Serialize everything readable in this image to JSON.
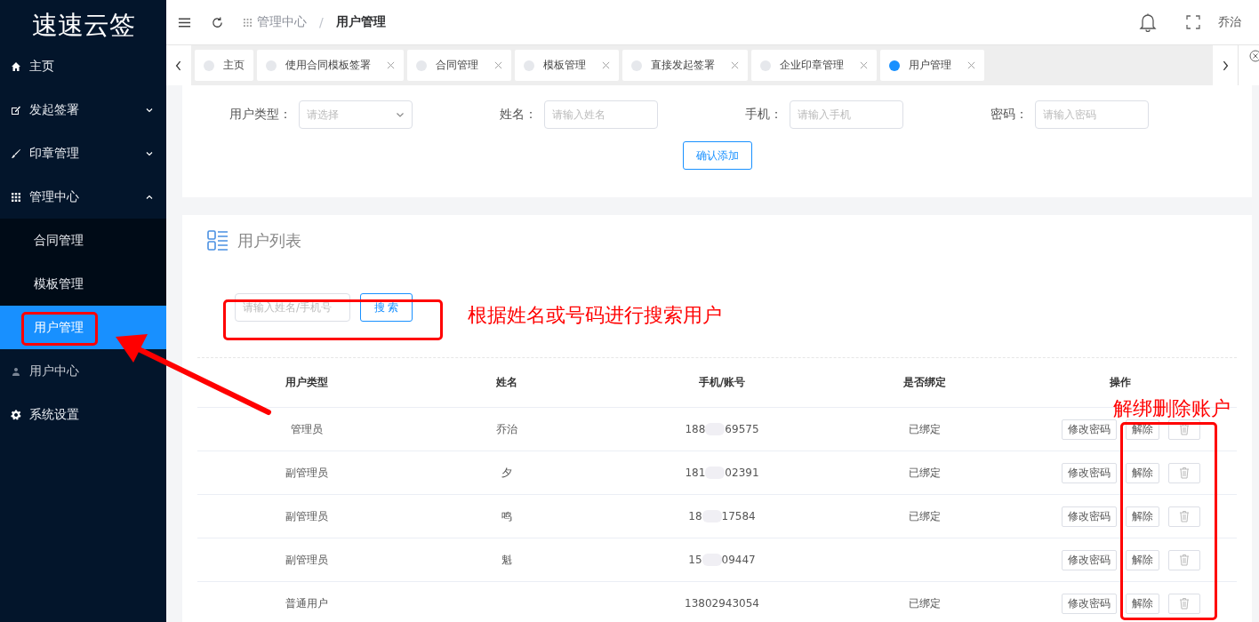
{
  "sidebar": {
    "logo": "速速云签",
    "items": [
      {
        "label": "主页",
        "selected": false
      },
      {
        "label": "发起签署",
        "expanded": false,
        "selected": false
      },
      {
        "label": "印章管理",
        "expanded": false,
        "selected": false
      },
      {
        "label": "管理中心",
        "expanded": true,
        "selected": false,
        "children": [
          {
            "label": "合同管理",
            "selected": false
          },
          {
            "label": "模板管理",
            "selected": false
          },
          {
            "label": "用户管理",
            "selected": true
          }
        ]
      },
      {
        "label": "用户中心",
        "selected": false
      },
      {
        "label": "系统设置",
        "selected": false
      }
    ]
  },
  "header": {
    "breadcrumb": [
      "管理中心",
      "/",
      "用户管理"
    ],
    "user": "乔治"
  },
  "tabs": [
    {
      "label": "主页",
      "closable": false,
      "selected": false
    },
    {
      "label": "使用合同模板签署",
      "closable": true,
      "selected": false
    },
    {
      "label": "合同管理",
      "closable": true,
      "selected": false
    },
    {
      "label": "模板管理",
      "closable": true,
      "selected": false
    },
    {
      "label": "直接发起签署",
      "closable": true,
      "selected": false
    },
    {
      "label": "企业印章管理",
      "closable": true,
      "selected": false
    },
    {
      "label": "用户管理",
      "closable": true,
      "selected": true
    }
  ],
  "add_form": {
    "fields": [
      {
        "label": "用户类型：",
        "kind": "select",
        "placeholder": "请选择"
      },
      {
        "label": "姓名：",
        "kind": "input",
        "placeholder": "请输入姓名"
      },
      {
        "label": "手机：",
        "kind": "input",
        "placeholder": "请输入手机"
      },
      {
        "label": "密码：",
        "kind": "input",
        "placeholder": "请输入密码"
      }
    ],
    "submit": "确认添加"
  },
  "user_list": {
    "title": "用户列表",
    "search": {
      "placeholder": "请输入姓名/手机号",
      "button": "搜 索"
    },
    "table": {
      "columns": [
        "用户类型",
        "姓名",
        "手机/账号",
        "是否绑定",
        "操作"
      ],
      "rows": [
        {
          "type": "管理员",
          "name": "乔治",
          "phone_start": "188",
          "phone_end": "69575",
          "bound": "已绑定",
          "actions": [
            "修改密码",
            "解除"
          ]
        },
        {
          "type": "副管理员",
          "name": "夕",
          "phone_start": "181",
          "phone_end": "02391",
          "bound": "已绑定",
          "actions": [
            "修改密码",
            "解除"
          ]
        },
        {
          "type": "副管理员",
          "name": "鸣",
          "phone_start": "18",
          "phone_end": "17584",
          "bound": "已绑定",
          "actions": [
            "修改密码",
            "解除"
          ]
        },
        {
          "type": "副管理员",
          "name": "魁",
          "phone_start": "15",
          "phone_end": "09447",
          "bound": "",
          "actions": [
            "修改密码",
            "解除"
          ]
        },
        {
          "type": "普通用户",
          "name": "",
          "phone_start": "13802943054",
          "phone_end": "",
          "bound": "已绑定",
          "actions": [
            "修改密码",
            "解除"
          ]
        }
      ]
    }
  },
  "annotations": [
    {
      "kind": "text",
      "text": "根据姓名或号码进行搜索用户"
    },
    {
      "kind": "text",
      "text": "解绑删除账户"
    }
  ]
}
